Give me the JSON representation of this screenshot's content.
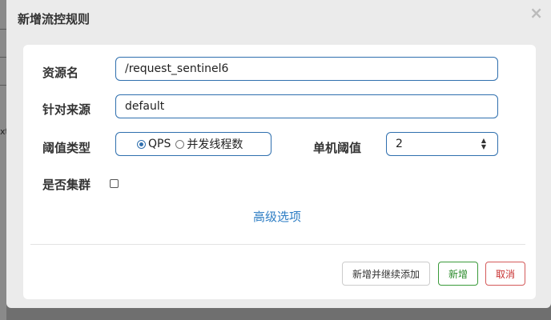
{
  "dialog": {
    "title": "新增流控规则",
    "close_symbol": "×"
  },
  "form": {
    "resource_label": "资源名",
    "resource_value": "/request_sentinel6",
    "source_label": "针对来源",
    "source_value": "default",
    "threshold_type_label": "阈值类型",
    "threshold_type_options": [
      "QPS",
      "并发线程数"
    ],
    "threshold_type_selected": "QPS",
    "single_threshold_label": "单机阈值",
    "single_threshold_value": "2",
    "cluster_label": "是否集群",
    "cluster_checked": false,
    "advanced_link": "高级选项"
  },
  "buttons": {
    "add_continue": "新增并继续添加",
    "add": "新增",
    "cancel": "取消"
  },
  "background": {
    "partial_text": "xt"
  },
  "colors": {
    "accent": "#2f6fae",
    "link": "#2d7dc4",
    "success": "#2a8a2a",
    "danger": "#c83030"
  }
}
